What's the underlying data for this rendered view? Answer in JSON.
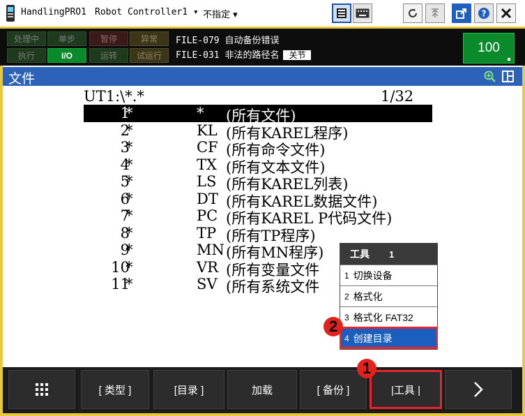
{
  "titlebar": {
    "app": "HandlingPRO1",
    "controller": "Robot Controller1",
    "mode": "不指定"
  },
  "status": {
    "leds": [
      {
        "label": "处理中",
        "state": "off",
        "color": "green"
      },
      {
        "label": "单步",
        "state": "off",
        "color": "green"
      },
      {
        "label": "暂停",
        "state": "off",
        "color": "red"
      },
      {
        "label": "异常",
        "state": "off",
        "color": "yellow"
      },
      {
        "label": "执行",
        "state": "off",
        "color": "green"
      },
      {
        "label": "I/O",
        "state": "on",
        "color": "green"
      },
      {
        "label": "运转",
        "state": "off",
        "color": "green"
      },
      {
        "label": "试运行",
        "state": "off",
        "color": "yellow"
      }
    ],
    "alarm1": "FILE-079 自动备份错误",
    "alarm2": "FILE-031 非法的路径名",
    "alarm_tag": "关节",
    "override": "100"
  },
  "screen": {
    "title": "文件",
    "path": "UT1:\\*.*",
    "page": "1/32"
  },
  "files": [
    {
      "num": "1",
      "star": "*",
      "ext": "*",
      "desc": "(所有文件)"
    },
    {
      "num": "2",
      "star": "*",
      "ext": "KL",
      "desc": "(所有KAREL程序)"
    },
    {
      "num": "3",
      "star": "*",
      "ext": "CF",
      "desc": "(所有命令文件)"
    },
    {
      "num": "4",
      "star": "*",
      "ext": "TX",
      "desc": "(所有文本文件)"
    },
    {
      "num": "5",
      "star": "*",
      "ext": "LS",
      "desc": "(所有KAREL列表)"
    },
    {
      "num": "6",
      "star": "*",
      "ext": "DT",
      "desc": "(所有KAREL数据文件)"
    },
    {
      "num": "7",
      "star": "*",
      "ext": "PC",
      "desc": "(所有KAREL P代码文件)"
    },
    {
      "num": "8",
      "star": "*",
      "ext": "TP",
      "desc": "(所有TP程序)"
    },
    {
      "num": "9",
      "star": "*",
      "ext": "MN",
      "desc": "(所有MN程序)"
    },
    {
      "num": "10",
      "star": "*",
      "ext": "VR",
      "desc": "(所有变量文件"
    },
    {
      "num": "11",
      "star": "*",
      "ext": "SV",
      "desc": "(所有系统文件"
    }
  ],
  "popup": {
    "title": "工具",
    "page": "1",
    "items": [
      {
        "num": "1",
        "label": "切换设备"
      },
      {
        "num": "2",
        "label": "格式化"
      },
      {
        "num": "3",
        "label": "格式化 FAT32"
      },
      {
        "num": "4",
        "label": "创建目录"
      }
    ]
  },
  "callouts": {
    "one": "1",
    "two": "2"
  },
  "fkeys": {
    "type": "[ 类型 ]",
    "dir": "[目录 ]",
    "load": "加载",
    "backup": "[ 备份 ]",
    "tools": "|工具 |"
  },
  "colors": {
    "header_blue": "#2c62b8",
    "highlight_blue": "#1a5fbf",
    "led_on_green": "#0b8a2c",
    "callout_red": "#e3221d",
    "frame_yellow": "#e8c93a"
  }
}
